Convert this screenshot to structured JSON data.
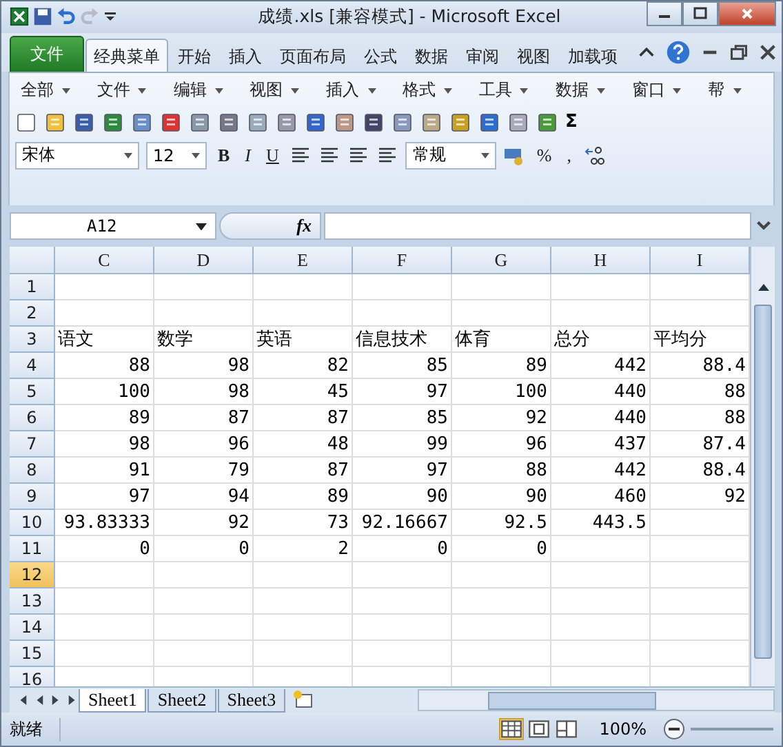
{
  "window": {
    "title": "成绩.xls  [兼容模式] - Microsoft Excel"
  },
  "ribbon_tabs": [
    {
      "label": "文件",
      "kind": "file",
      "selected": false
    },
    {
      "label": "经典菜单",
      "kind": "tab",
      "selected": true
    },
    {
      "label": "开始",
      "kind": "tab",
      "selected": false
    },
    {
      "label": "插入",
      "kind": "tab",
      "selected": false
    },
    {
      "label": "页面布局",
      "kind": "tab",
      "selected": false
    },
    {
      "label": "公式",
      "kind": "tab",
      "selected": false
    },
    {
      "label": "数据",
      "kind": "tab",
      "selected": false
    },
    {
      "label": "审阅",
      "kind": "tab",
      "selected": false
    },
    {
      "label": "视图",
      "kind": "tab",
      "selected": false
    },
    {
      "label": "加载项",
      "kind": "tab",
      "selected": false
    }
  ],
  "classic_menus": [
    "全部",
    "文件",
    "编辑",
    "视图",
    "插入",
    "格式",
    "工具",
    "数据",
    "窗口",
    "帮"
  ],
  "format_toolbar": {
    "font": "宋体",
    "size": "12",
    "bold": "B",
    "italic": "I",
    "underline": "U",
    "number_format": "常规",
    "percent": "%",
    "comma": ","
  },
  "sum_label": "Σ",
  "formula_bar": {
    "name_box": "A12",
    "fx": "fx"
  },
  "columns": [
    "C",
    "D",
    "E",
    "F",
    "G",
    "H",
    "I"
  ],
  "rows": [
    {
      "number": "1",
      "selected": false
    },
    {
      "number": "2",
      "selected": false
    },
    {
      "number": "3",
      "selected": false,
      "kind": "labels",
      "cells": [
        "语文",
        "数学",
        "英语",
        "信息技术",
        "体育",
        "总分",
        "平均分"
      ]
    },
    {
      "number": "4",
      "selected": false,
      "cells": [
        "88",
        "98",
        "82",
        "85",
        "89",
        "442",
        "88.4"
      ]
    },
    {
      "number": "5",
      "selected": false,
      "cells": [
        "100",
        "98",
        "45",
        "97",
        "100",
        "440",
        "88"
      ]
    },
    {
      "number": "6",
      "selected": false,
      "cells": [
        "89",
        "87",
        "87",
        "85",
        "92",
        "440",
        "88"
      ]
    },
    {
      "number": "7",
      "selected": false,
      "cells": [
        "98",
        "96",
        "48",
        "99",
        "96",
        "437",
        "87.4"
      ]
    },
    {
      "number": "8",
      "selected": false,
      "cells": [
        "91",
        "79",
        "87",
        "97",
        "88",
        "442",
        "88.4"
      ]
    },
    {
      "number": "9",
      "selected": false,
      "cells": [
        "97",
        "94",
        "89",
        "90",
        "90",
        "460",
        "92"
      ]
    },
    {
      "number": "10",
      "selected": false,
      "cells": [
        "93.83333",
        "92",
        "73",
        "92.16667",
        "92.5",
        "443.5"
      ]
    },
    {
      "number": "11",
      "selected": false,
      "cells": [
        "0",
        "0",
        "2",
        "0",
        "0"
      ]
    },
    {
      "number": "12",
      "selected": true
    },
    {
      "number": "13",
      "selected": false
    },
    {
      "number": "14",
      "selected": false
    },
    {
      "number": "15",
      "selected": false
    },
    {
      "number": "16",
      "selected": false
    }
  ],
  "sheet_tabs": [
    {
      "label": "Sheet1",
      "selected": true
    },
    {
      "label": "Sheet2",
      "selected": false
    },
    {
      "label": "Sheet3",
      "selected": false
    }
  ],
  "status_bar": {
    "status": "就绪",
    "zoom": "100%"
  }
}
